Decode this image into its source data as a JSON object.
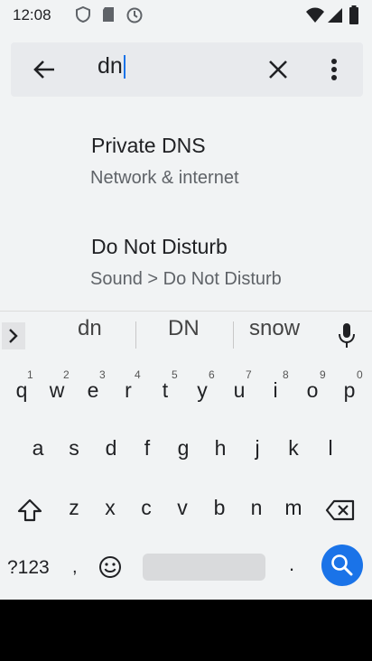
{
  "status_bar": {
    "time": "12:08"
  },
  "search": {
    "query": "dn"
  },
  "results": [
    {
      "title": "Private DNS",
      "subtitle": "Network & internet"
    },
    {
      "title": "Do Not Disturb",
      "subtitle": "Sound > Do Not Disturb"
    }
  ],
  "keyboard": {
    "suggestions": [
      "dn",
      "DN",
      "snow"
    ],
    "row1": [
      "q",
      "w",
      "e",
      "r",
      "t",
      "y",
      "u",
      "i",
      "o",
      "p"
    ],
    "row1_digits": [
      "1",
      "2",
      "3",
      "4",
      "5",
      "6",
      "7",
      "8",
      "9",
      "0"
    ],
    "row2": [
      "a",
      "s",
      "d",
      "f",
      "g",
      "h",
      "j",
      "k",
      "l"
    ],
    "row3": [
      "z",
      "x",
      "c",
      "v",
      "b",
      "n",
      "m"
    ],
    "symbols_label": "?123",
    "comma": ",",
    "period": "."
  },
  "colors": {
    "accent": "#1a73e8",
    "background": "#f1f3f4"
  }
}
